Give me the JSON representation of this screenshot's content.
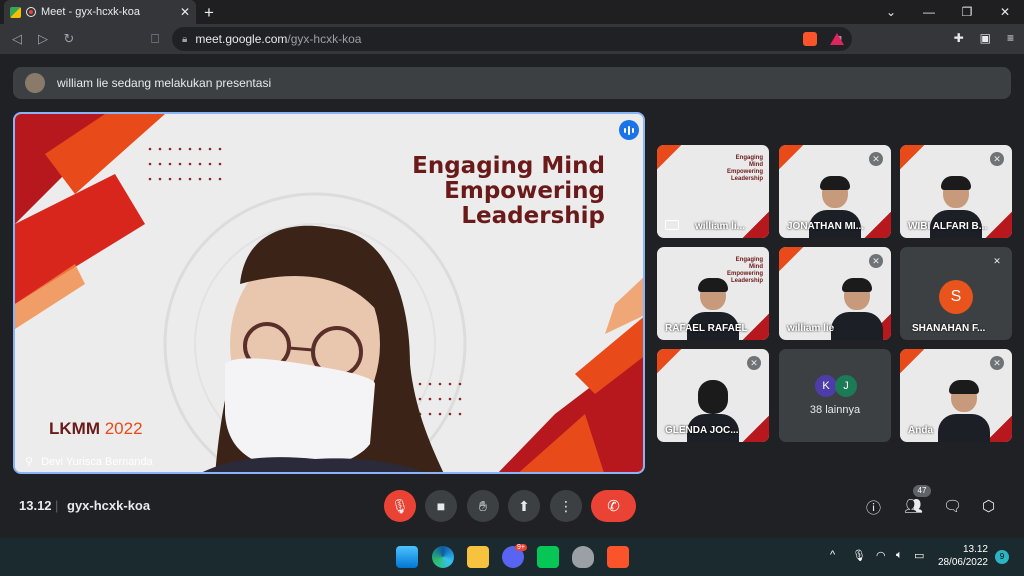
{
  "browser": {
    "tab_title": "Meet - gyx-hcxk-koa",
    "tab_close": "✕",
    "new_tab": "+",
    "url_host": "meet.google.com",
    "url_path": "/gyx-hcxk-koa"
  },
  "banner": {
    "text": "william lie sedang melakukan presentasi"
  },
  "presentation": {
    "title_line1": "Engaging Mind",
    "title_line2": "Empowering",
    "title_line3": "Leadership",
    "event": "LKMM",
    "year": "2022",
    "presenter_name": "Devi Yurisca Bernanda"
  },
  "tiles": [
    {
      "name": "william li..."
    },
    {
      "name": "JONATHAN MI..."
    },
    {
      "name": "WIBI ALFARI B..."
    },
    {
      "name": "RAFAEL RAFAEL"
    },
    {
      "name": "william lie"
    },
    {
      "name": "SHANAHAN F...",
      "initial": "S"
    },
    {
      "name": "GLENDA JOC..."
    },
    {
      "name": "38 lainnya",
      "initials": [
        "K",
        "J"
      ]
    },
    {
      "name": "Anda"
    }
  ],
  "controls": {
    "time": "13.12",
    "separator": "|",
    "meeting_code": "gyx-hcxk-koa",
    "participants_count": "47"
  },
  "taskbar": {
    "clock_time": "13.12",
    "clock_date": "28/06/2022",
    "notifications": "9",
    "discord_badge": "9+"
  },
  "colors": {
    "accent_blue": "#8ab4f8",
    "danger_red": "#ea4335",
    "slide_dark_red": "#6b1a1a",
    "slide_orange": "#e84a1a"
  }
}
